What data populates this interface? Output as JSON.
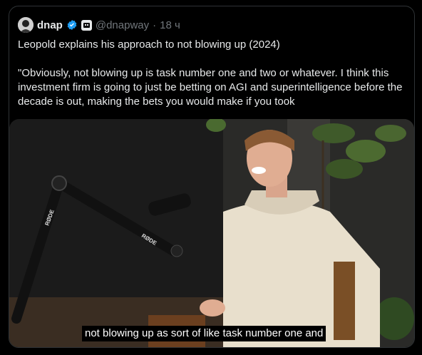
{
  "author": {
    "name": "dnap",
    "handle": "@dnapway",
    "separator": "·",
    "time": "18 ч"
  },
  "tweet": {
    "line1": "Leopold explains his approach to not blowing up (2024)",
    "line2": "\"Obviously, not blowing up is task number one and two or whatever. I think this investment firm is going to just be betting on AGI and superintelligence before the decade is out, making the bets you would make if you took"
  },
  "media": {
    "caption": "not blowing up as sort of like task number one and",
    "mic_brand_1": "RØDE",
    "mic_brand_2": "RØDE"
  },
  "colors": {
    "verified": "#1d9bf0",
    "text": "#e7e9ea",
    "muted": "#71767b"
  }
}
